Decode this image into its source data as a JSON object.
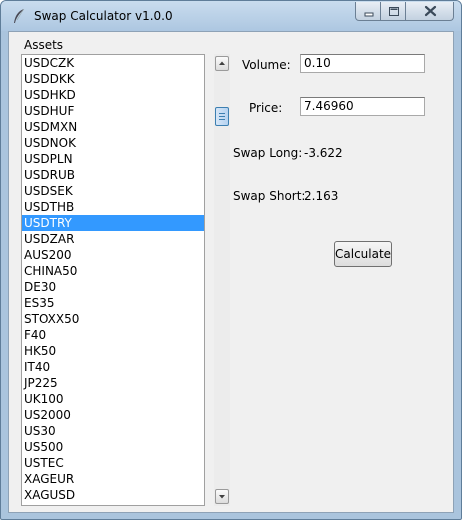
{
  "window": {
    "title": "Swap Calculator v1.0.0",
    "accent": "#3399ff"
  },
  "menu": {
    "assets_label": "Assets"
  },
  "assets": {
    "items": [
      "USDCZK",
      "USDDKK",
      "USDHKD",
      "USDHUF",
      "USDMXN",
      "USDNOK",
      "USDPLN",
      "USDRUB",
      "USDSEK",
      "USDTHB",
      "USDTRY",
      "USDZAR",
      "AUS200",
      "CHINA50",
      "DE30",
      "ES35",
      "STOXX50",
      "F40",
      "HK50",
      "IT40",
      "JP225",
      "UK100",
      "US2000",
      "US30",
      "US500",
      "USTEC",
      "XAGEUR",
      "XAGUSD"
    ],
    "selected": "USDTRY"
  },
  "form": {
    "volume_label": "Volume:",
    "volume_value": "0.10",
    "price_label": "Price:",
    "price_value": "7.46960",
    "swap_long_label": "Swap Long:",
    "swap_long_value": "-3.622",
    "swap_short_label": "Swap Short:",
    "swap_short_value": "2.163",
    "calculate_label": "Calculate"
  }
}
